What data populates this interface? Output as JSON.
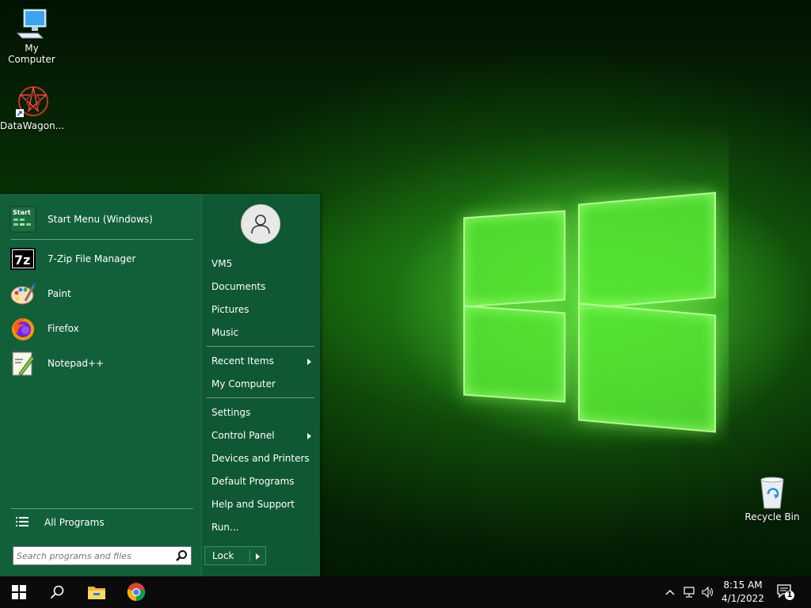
{
  "desktop": {
    "icons": [
      {
        "label": "My Computer",
        "icon": "computer-icon"
      },
      {
        "label": "DataWagon...",
        "icon": "datawagon-shortcut-icon"
      },
      {
        "label": "Recycle Bin",
        "icon": "recycle-bin-icon"
      }
    ]
  },
  "start_menu": {
    "pinned": [
      {
        "label": "Start Menu (Windows)",
        "icon": "start-menu-settings-icon",
        "icon_text": "Start"
      }
    ],
    "programs": [
      {
        "label": "7-Zip File Manager",
        "icon": "7zip-icon",
        "icon_text": "7z"
      },
      {
        "label": "Paint",
        "icon": "paint-icon"
      },
      {
        "label": "Firefox",
        "icon": "firefox-icon"
      },
      {
        "label": "Notepad++",
        "icon": "notepadpp-icon"
      }
    ],
    "all_programs": "All Programs",
    "search_placeholder": "Search programs and files",
    "right": {
      "user": "VM5",
      "places": [
        "Documents",
        "Pictures",
        "Music"
      ],
      "recent_items": "Recent Items",
      "my_computer": "My Computer",
      "settings": "Settings",
      "control_panel": "Control Panel",
      "devices": "Devices and Printers",
      "default_programs": "Default Programs",
      "help": "Help and Support",
      "run": "Run...",
      "lock": "Lock"
    }
  },
  "taskbar": {
    "time": "8:15 AM",
    "date": "4/1/2022",
    "notification_count": "1"
  },
  "colors": {
    "menu_bg": "#12603a",
    "taskbar_bg": "#0b0b0b",
    "wallpaper_glow": "#55e632"
  }
}
